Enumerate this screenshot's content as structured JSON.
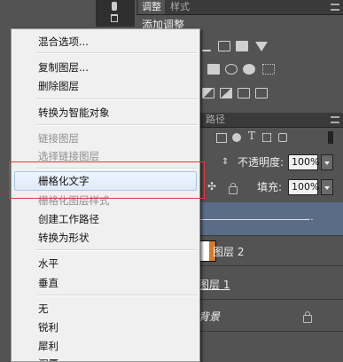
{
  "top_panel": {
    "tab_active": "调整",
    "tab_inactive": "样式",
    "section_title": "添加调整"
  },
  "layers_panel": {
    "tab_label": "路径",
    "opacity_label": "不透明度:",
    "opacity_value": "100%",
    "fill_label": "填充:",
    "fill_value": "100%",
    "layer_filter_icons": [
      "image-filter-icon",
      "adjust-filter-icon",
      "type-filter-icon",
      "shape-filter-icon",
      "smart-object-filter-icon"
    ],
    "layers": [
      {
        "name": "",
        "selected": true
      },
      {
        "name": "图层 2",
        "selected": false
      },
      {
        "name": "图层 1",
        "selected": false
      },
      {
        "name": "背景",
        "selected": false,
        "locked": true
      }
    ]
  },
  "context_menu": {
    "groups": [
      [
        {
          "label": "混合选项...",
          "enabled": true
        }
      ],
      [
        {
          "label": "复制图层...",
          "enabled": true
        },
        {
          "label": "删除图层",
          "enabled": true
        }
      ],
      [
        {
          "label": "转换为智能对象",
          "enabled": true
        }
      ],
      [
        {
          "label": "链接图层",
          "enabled": false
        },
        {
          "label": "选择链接图层",
          "enabled": false
        }
      ],
      [
        {
          "label": "栅格化文字",
          "enabled": true,
          "highlighted": true
        },
        {
          "label": "栅格化图层样式",
          "enabled": false
        },
        {
          "label": "创建工作路径",
          "enabled": true
        },
        {
          "label": "转换为形状",
          "enabled": true
        }
      ],
      [
        {
          "label": "水平",
          "enabled": true
        },
        {
          "label": "垂直",
          "enabled": true
        }
      ],
      [
        {
          "label": "无",
          "enabled": true
        },
        {
          "label": "锐利",
          "enabled": true
        },
        {
          "label": "犀利",
          "enabled": true
        },
        {
          "label": "浑厚",
          "enabled": true
        }
      ]
    ]
  },
  "colors": {
    "highlight_border": "#a5c7ef",
    "annotation_box": "#e0393e",
    "selected_layer": "#5b6c86"
  }
}
